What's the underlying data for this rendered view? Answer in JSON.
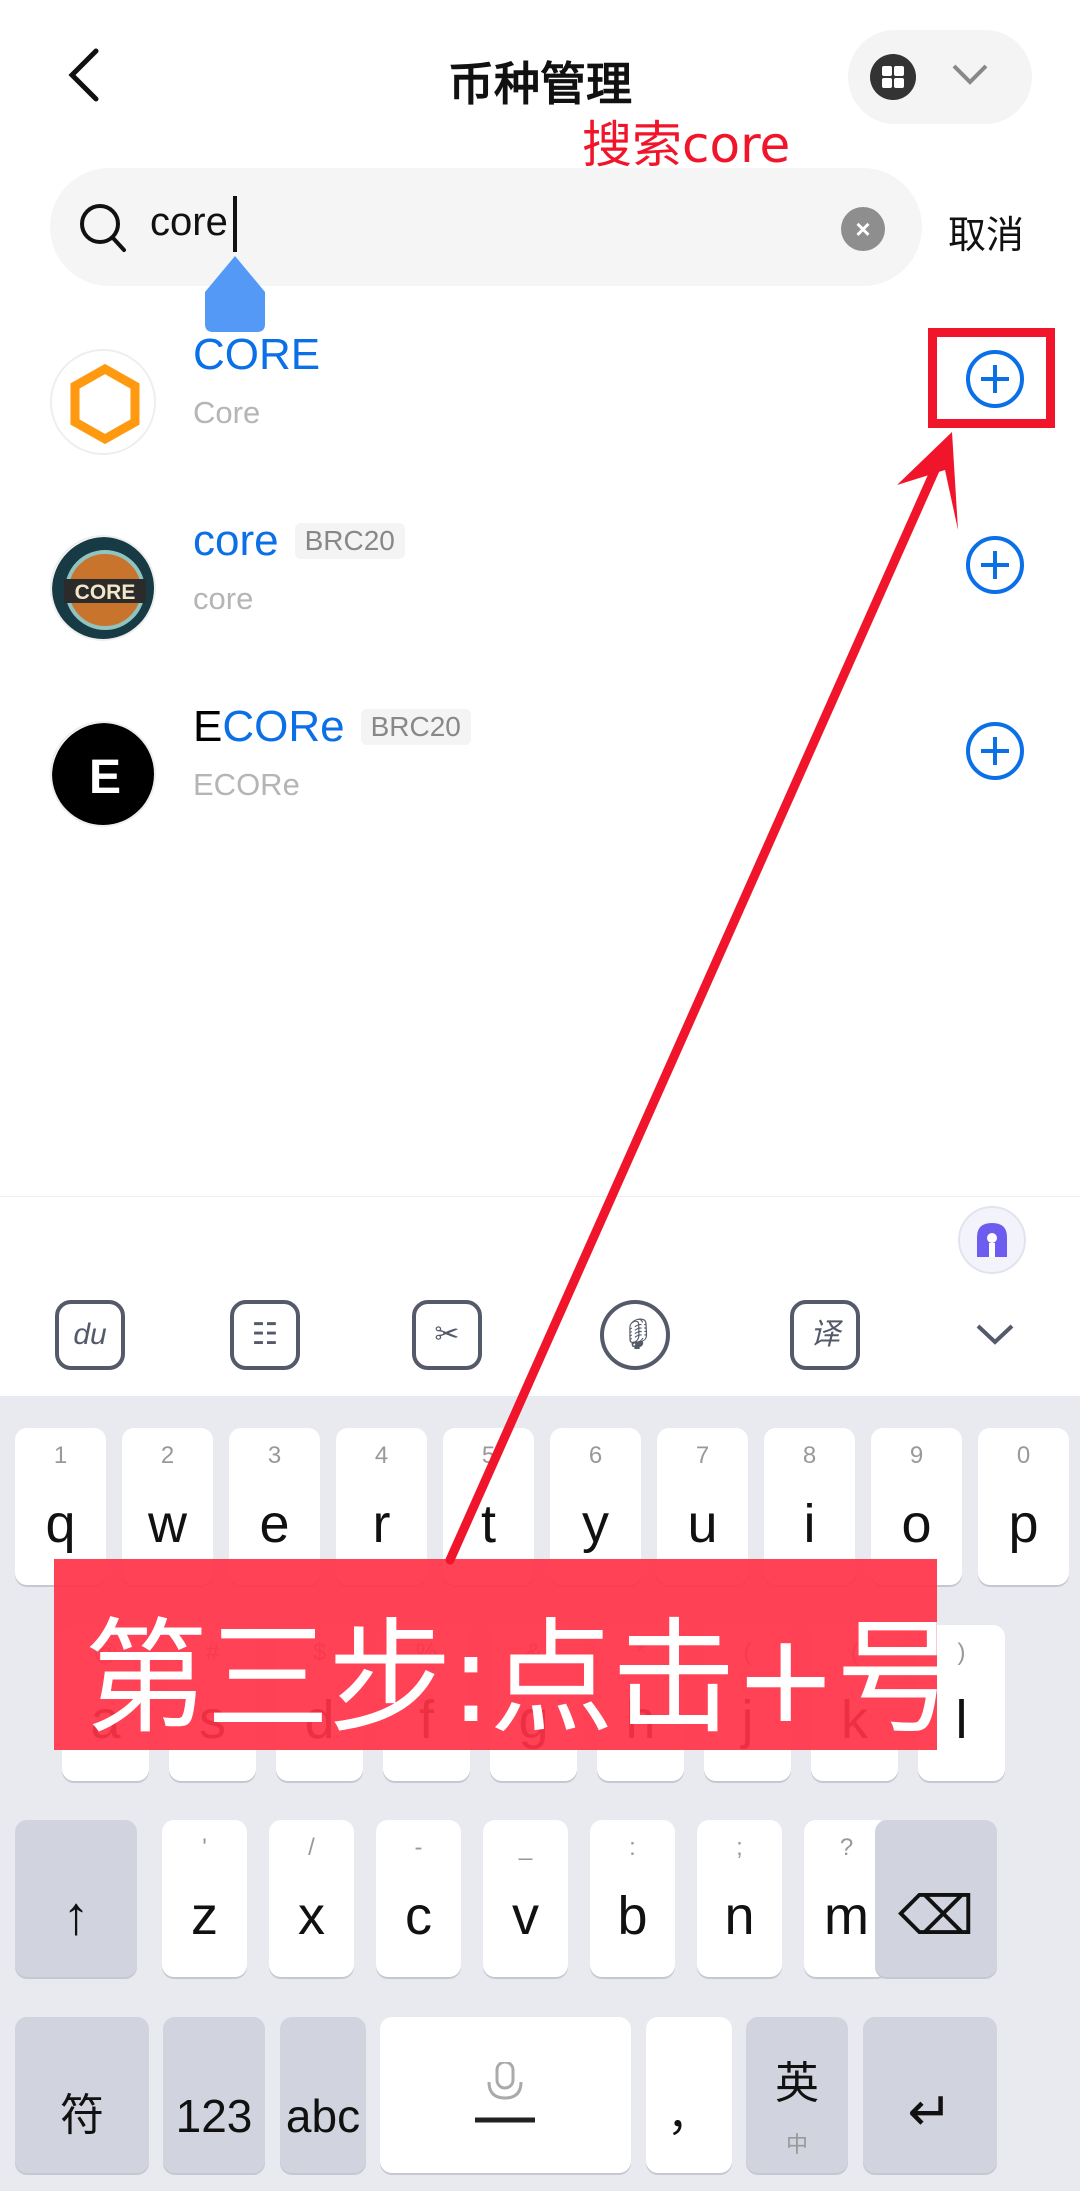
{
  "header": {
    "title": "币种管理",
    "back_icon": "chevron-left-icon",
    "menu_icon": "grid-icon",
    "dropdown_icon": "chevron-down-icon"
  },
  "annotations": {
    "search_hint": "搜索core",
    "step": "第三步:点击+号",
    "accent": "#f0152a"
  },
  "search": {
    "value": "core",
    "cancel_label": "取消",
    "icon": "search-icon",
    "clear_icon": "close-icon"
  },
  "results": [
    {
      "prefix": "",
      "match": "CORE",
      "tag": "",
      "subtitle": "Core",
      "icon": "hexagon-logo"
    },
    {
      "prefix": "",
      "match": "core",
      "tag": "BRC20",
      "subtitle": "core",
      "icon": "core-bitcoin-logo"
    },
    {
      "prefix": "E",
      "match": "CORe",
      "tag": "BRC20",
      "subtitle": "ECORe",
      "icon": "e-logo"
    }
  ],
  "colors": {
    "link": "#0b6fe8",
    "subtitle": "#b5b5b5"
  },
  "keyboard": {
    "toolbar": [
      "du-bear-icon",
      "keyboard-layout-icon",
      "clipboard-scissors-icon",
      "microphone-icon",
      "translate-icon",
      "collapse-chevron-icon"
    ],
    "row1": [
      [
        "q",
        "1"
      ],
      [
        "w",
        "2"
      ],
      [
        "e",
        "3"
      ],
      [
        "r",
        "4"
      ],
      [
        "t",
        "5"
      ],
      [
        "y",
        "6"
      ],
      [
        "u",
        "7"
      ],
      [
        "i",
        "8"
      ],
      [
        "o",
        "9"
      ],
      [
        "p",
        "0"
      ]
    ],
    "row2": [
      [
        "a",
        "@"
      ],
      [
        "s",
        "#"
      ],
      [
        "d",
        "$"
      ],
      [
        "f",
        "%"
      ],
      [
        "g",
        "&"
      ],
      [
        "h",
        "*"
      ],
      [
        "j",
        "("
      ],
      [
        "k",
        "("
      ],
      [
        "l",
        ")"
      ]
    ],
    "row3": [
      [
        "z",
        "'"
      ],
      [
        "x",
        "/"
      ],
      [
        "c",
        "-"
      ],
      [
        "v",
        "_"
      ],
      [
        "b",
        ":"
      ],
      [
        "n",
        ";"
      ],
      [
        "m",
        "?"
      ]
    ],
    "row4": {
      "symbols": "符",
      "numbers": "123",
      "abc": "abc",
      "comma": "，",
      "lang": "英",
      "lang_sub": "中"
    }
  }
}
